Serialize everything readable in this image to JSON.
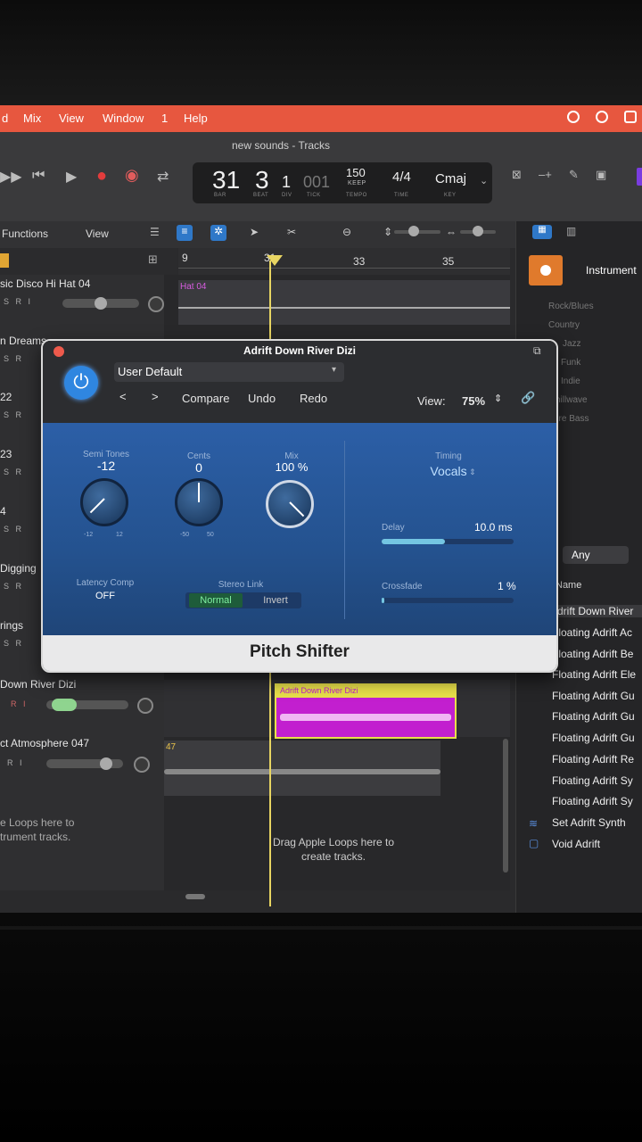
{
  "menu": {
    "items": [
      "d",
      "Mix",
      "View",
      "Window",
      "1",
      "Help"
    ]
  },
  "window": {
    "title": "new sounds - Tracks"
  },
  "lcd": {
    "bar": "31",
    "beat": "3",
    "div": "1",
    "tick": "001",
    "tempo": "150",
    "tempo_label": "KEEP",
    "time_sig": "4/4",
    "key": "Cmaj",
    "labels": {
      "bar": "BAR",
      "beat": "BEAT",
      "div": "DIV",
      "tick": "TICK",
      "tempo": "TEMPO",
      "time": "TIME",
      "key": "KEY"
    }
  },
  "toolbar": {
    "functions": "Functions",
    "view": "View"
  },
  "ruler": {
    "marks": [
      "9",
      "31",
      "33",
      "35"
    ]
  },
  "tracks": [
    {
      "name": "sic Disco Hi Hat 04"
    },
    {
      "name": "n Dreams"
    },
    {
      "name": "22"
    },
    {
      "name": "23"
    },
    {
      "name": "4"
    },
    {
      "name": "Digging"
    },
    {
      "name": "rings"
    },
    {
      "name": "Down River Dizi"
    },
    {
      "name": "ct Atmosphere 047"
    }
  ],
  "regions": {
    "hihat": "Hat 04",
    "dizi": "Adrift Down River Dizi",
    "atmos": "47"
  },
  "drop_hint": {
    "left": "e Loops here to\ntrument tracks.",
    "main": "Drag Apple Loops here to\ncreate tracks."
  },
  "plugin": {
    "title": "Adrift Down River Dizi",
    "preset": "User Default",
    "compare": "Compare",
    "undo": "Undo",
    "redo": "Redo",
    "view_label": "View:",
    "view_value": "75%",
    "params": {
      "semitones": {
        "label": "Semi Tones",
        "value": "-12",
        "min": "-12",
        "max": "12"
      },
      "cents": {
        "label": "Cents",
        "value": "0",
        "min": "-50",
        "max": "50"
      },
      "mix": {
        "label": "Mix",
        "value": "100 %"
      },
      "timing": {
        "label": "Timing",
        "value": "Vocals"
      },
      "delay": {
        "label": "Delay",
        "value": "10.0 ms",
        "fraction": 0.48
      },
      "crossfade": {
        "label": "Crossfade",
        "value": "1 %",
        "fraction": 0.02
      },
      "latency": {
        "label": "Latency Comp",
        "value": "OFF"
      },
      "stereo": {
        "label": "Stereo Link",
        "normal": "Normal",
        "invert": "Invert"
      }
    },
    "name": "Pitch Shifter"
  },
  "library": {
    "header": "Instrument",
    "categories": [
      "Rock/Blues",
      "Country",
      "Jazz",
      "Funk",
      "Indie",
      "hillwave",
      "ure Bass"
    ],
    "filter": "Any",
    "column": "Name",
    "items": [
      "Adrift Down River",
      "Floating Adrift Ac",
      "Floating Adrift Be",
      "Floating Adrift Ele",
      "Floating Adrift Gu",
      "Floating Adrift Gu",
      "Floating Adrift Gu",
      "Floating Adrift Re",
      "Floating Adrift Sy",
      "Floating Adrift Sy",
      "Set Adrift Synth",
      "Void Adrift"
    ]
  },
  "colors": {
    "accent": "#e7573f",
    "plugin_blue": "#2c5fa7",
    "region": "#c21fcf",
    "playhead": "#e8d562"
  }
}
